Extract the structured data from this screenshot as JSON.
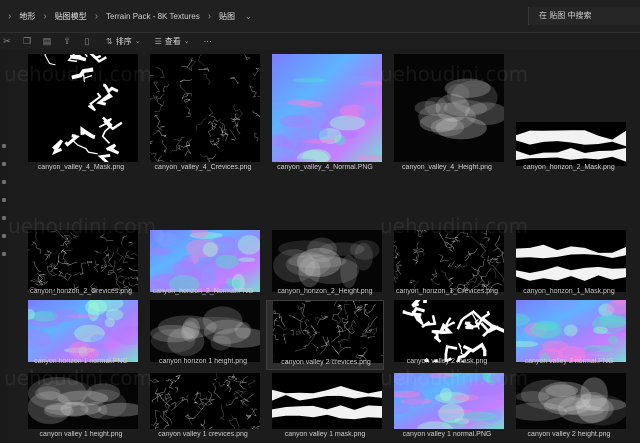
{
  "breadcrumbs": [
    "地形",
    "贴图模型",
    "Terrain Pack - 8K Textures",
    "贴图"
  ],
  "search": {
    "placeholder": "在 贴图 中搜索"
  },
  "toolbar": {
    "sort_label": "排序",
    "view_label": "查看",
    "more_label": "···"
  },
  "watermark": "uehoudini.com",
  "files": [
    {
      "name": "canyon_valley_4_Mask.png",
      "kind": "mask"
    },
    {
      "name": "canyon_valley_4_Crevices.png",
      "kind": "crevice"
    },
    {
      "name": "canyon_valley_4_Normal.PNG",
      "kind": "normal"
    },
    {
      "name": "canyon_valley_4_Height.png",
      "kind": "height"
    },
    {
      "name": "canyon_horizon_2_Mask.png",
      "kind": "maskband"
    },
    {
      "name": "canyon_horizon_2_Crevices.png",
      "kind": "crevice"
    },
    {
      "name": "canyon_horizon_2_Normal.PNG",
      "kind": "normal"
    },
    {
      "name": "canyon_horizon_2_Height.png",
      "kind": "height"
    },
    {
      "name": "canyon_horizon_1_Crevices.png",
      "kind": "crevice"
    },
    {
      "name": "canyon_horizon_1_Mask.png",
      "kind": "maskband"
    },
    {
      "name": "canyon horizon 1 normal.PNG",
      "kind": "normal"
    },
    {
      "name": "canyon horizon 1 height.png",
      "kind": "height"
    },
    {
      "name": "canyon valley 2 crevices.png",
      "kind": "crevice"
    },
    {
      "name": "canyon valley 2 mask.png",
      "kind": "mask"
    },
    {
      "name": "canyon valley 2 normal.PNG",
      "kind": "normal"
    },
    {
      "name": "canyon valley 1 height.png",
      "kind": "height"
    },
    {
      "name": "canyon valley 1 crevices.png",
      "kind": "crevice"
    },
    {
      "name": "canyon valley 1 mask.png",
      "kind": "maskband"
    },
    {
      "name": "canyon valley 1 normal.PNG",
      "kind": "normal"
    },
    {
      "name": "canyon valley 2 height.png",
      "kind": "height"
    }
  ]
}
